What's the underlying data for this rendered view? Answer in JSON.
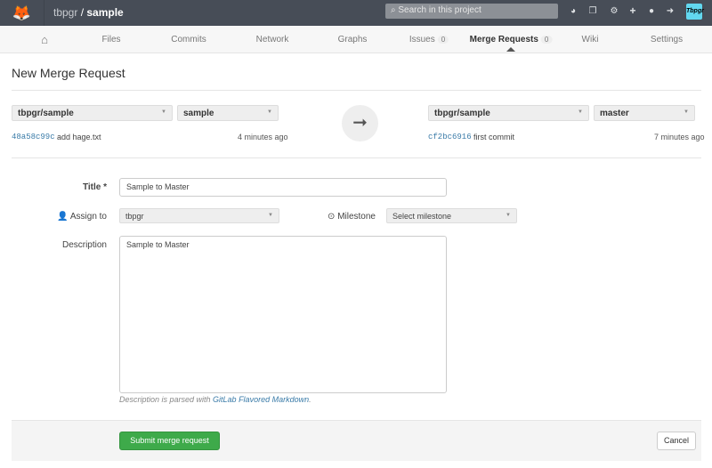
{
  "header": {
    "namespace": "tbpgr",
    "separator": " / ",
    "project": "sample",
    "search_placeholder": "Search in this project",
    "avatar_text": "Tbpgr",
    "icons": [
      "globe-icon",
      "copy-icon",
      "gears-icon",
      "plus-icon",
      "user-icon",
      "sign-out-icon"
    ]
  },
  "nav": {
    "items": [
      {
        "label": ""
      },
      {
        "label": "Files"
      },
      {
        "label": "Commits"
      },
      {
        "label": "Network"
      },
      {
        "label": "Graphs"
      },
      {
        "label": "Issues",
        "count": "0"
      },
      {
        "label": "Merge Requests",
        "count": "0"
      },
      {
        "label": "Wiki"
      },
      {
        "label": "Settings"
      }
    ],
    "active": "Merge Requests"
  },
  "page": {
    "title": "New Merge Request"
  },
  "source": {
    "project": "tbpgr/sample",
    "branch": "sample",
    "sha": "48a58c99c",
    "message": "add hage.txt",
    "time": "4 minutes ago"
  },
  "target": {
    "project": "tbpgr/sample",
    "branch": "master",
    "sha": "cf2bc6916",
    "message": "first commit",
    "time": "7 minutes ago"
  },
  "form": {
    "title_label": "Title *",
    "title_value": "Sample to Master",
    "assign_label": "Assign to",
    "assign_value": "tbpgr",
    "milestone_label": "Milestone",
    "milestone_value": "Select milestone",
    "description_label": "Description",
    "description_value": "Sample to Master",
    "hint_prefix": "Description is parsed with ",
    "hint_link": "GitLab Flavored Markdown",
    "hint_suffix": "."
  },
  "actions": {
    "submit": "Submit merge request",
    "cancel": "Cancel"
  },
  "colors": {
    "topbar": "#474d57",
    "submit": "#3eaa4a",
    "link": "#3a7ba8"
  }
}
